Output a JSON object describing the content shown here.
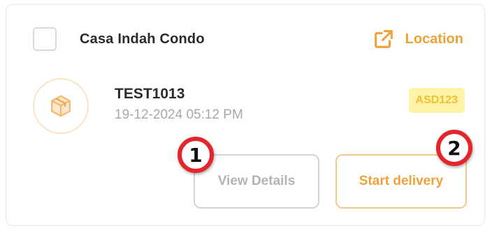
{
  "card": {
    "title": "Casa Indah Condo",
    "location_label": "Location",
    "order_id": "TEST1013",
    "order_time": "19-12-2024 05:12 PM",
    "badge": "ASD123",
    "view_details_label": "View Details",
    "start_delivery_label": "Start delivery"
  },
  "markers": [
    "1",
    "2"
  ],
  "icons": {
    "location": "external-link-icon",
    "package": "package-icon"
  },
  "colors": {
    "accent": "#f0a23a",
    "badge_bg": "#fdf3a6",
    "badge_text": "#f1bf2e",
    "marker_ring": "#e3262b"
  }
}
